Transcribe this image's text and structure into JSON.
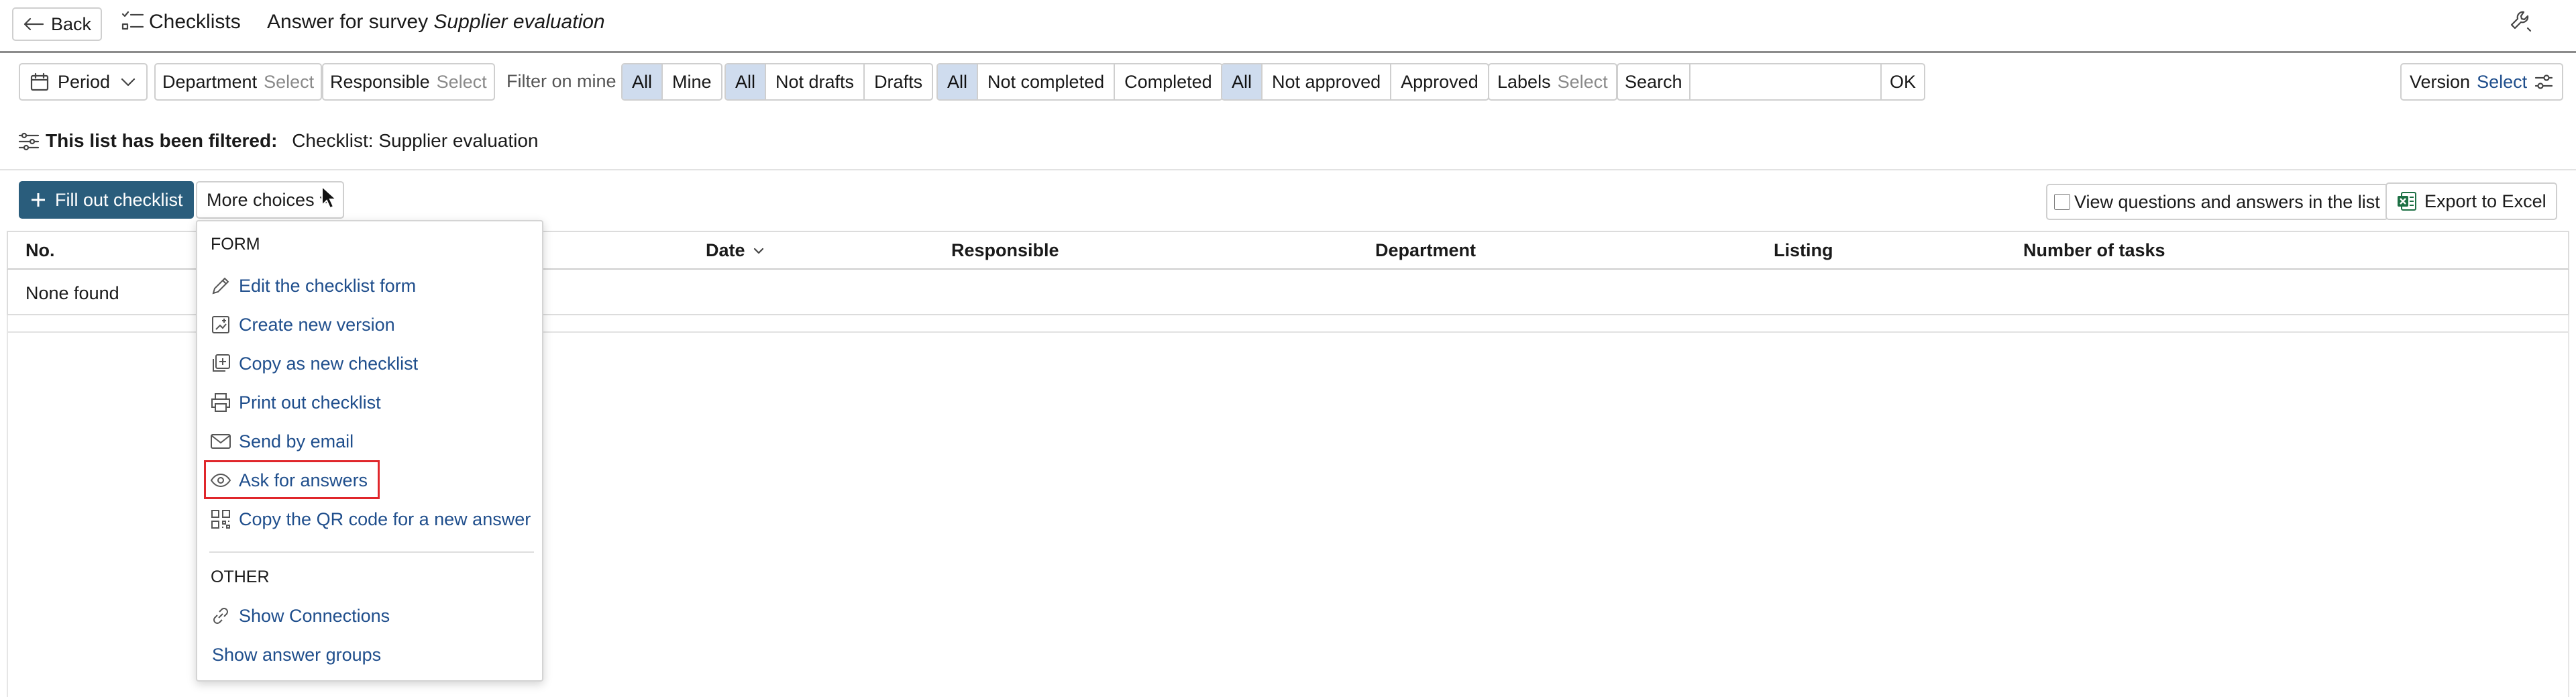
{
  "header": {
    "back_label": "Back",
    "module_label": "Checklists",
    "title_prefix": "Answer for survey",
    "title_survey": "Supplier evaluation"
  },
  "filters": {
    "period_label": "Period",
    "department_label": "Department",
    "department_value": "Select",
    "responsible_label": "Responsible",
    "responsible_value": "Select",
    "filter_on_mine_label": "Filter on mine",
    "mine_group": [
      "All",
      "Mine"
    ],
    "drafts_group": [
      "All",
      "Not drafts",
      "Drafts"
    ],
    "completed_group": [
      "All",
      "Not completed",
      "Completed"
    ],
    "approved_group": [
      "All",
      "Not approved",
      "Approved"
    ],
    "labels_label": "Labels",
    "labels_value": "Select",
    "search_label": "Search",
    "search_value": "",
    "ok_label": "OK",
    "version_label": "Version",
    "version_value": "Select"
  },
  "filter_notice": {
    "label": "This list has been filtered:",
    "value": "Checklist: Supplier evaluation"
  },
  "actions": {
    "fill_out_label": "Fill out checklist",
    "more_choices_label": "More choices",
    "view_qa_label": "View questions and answers in the list",
    "view_qa_checked": false,
    "export_label": "Export to Excel"
  },
  "table": {
    "columns": [
      "No.",
      "Date",
      "Responsible",
      "Department",
      "Listing",
      "Number of tasks"
    ],
    "empty_text": "None found"
  },
  "menu": {
    "form_header": "FORM",
    "form_items": [
      {
        "label": "Edit the checklist form",
        "icon": "pencil-icon"
      },
      {
        "label": "Create new version",
        "icon": "new-version-icon"
      },
      {
        "label": "Copy as new checklist",
        "icon": "copy-icon"
      },
      {
        "label": "Print out checklist",
        "icon": "printer-icon"
      },
      {
        "label": "Send by email",
        "icon": "email-icon"
      },
      {
        "label": "Ask for answers",
        "icon": "eye-icon",
        "highlighted": true
      },
      {
        "label": "Copy the QR code for a new answer",
        "icon": "qr-code-icon"
      }
    ],
    "other_header": "OTHER",
    "other_items": [
      {
        "label": "Show Connections",
        "icon": "link-icon"
      },
      {
        "label": "Show answer groups",
        "icon": ""
      }
    ]
  },
  "colors": {
    "primary_button": "#2a5d7c",
    "link": "#1f4e8c",
    "active_segment": "#cfdcee",
    "highlight_border": "#e0262b"
  }
}
